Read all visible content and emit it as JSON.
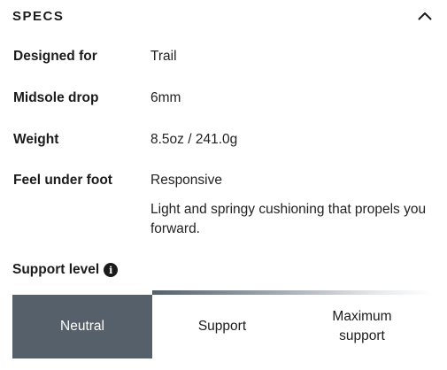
{
  "header": {
    "title": "SPECS",
    "collapse_icon": "chevron-up-icon"
  },
  "specs": [
    {
      "label": "Designed for",
      "value": "Trail"
    },
    {
      "label": "Midsole drop",
      "value": "6mm"
    },
    {
      "label": "Weight",
      "value": "8.5oz / 241.0g"
    },
    {
      "label": "Feel under foot",
      "value": "Responsive"
    }
  ],
  "feel_description": "Light and springy cushioning that propels you forward.",
  "support": {
    "heading": "Support level",
    "info_icon": "info-icon",
    "options": [
      {
        "label": "Neutral",
        "selected": true
      },
      {
        "label": "Support",
        "selected": false
      },
      {
        "label": "Maximum support",
        "selected": false
      }
    ],
    "selected_color": "#55606b"
  }
}
